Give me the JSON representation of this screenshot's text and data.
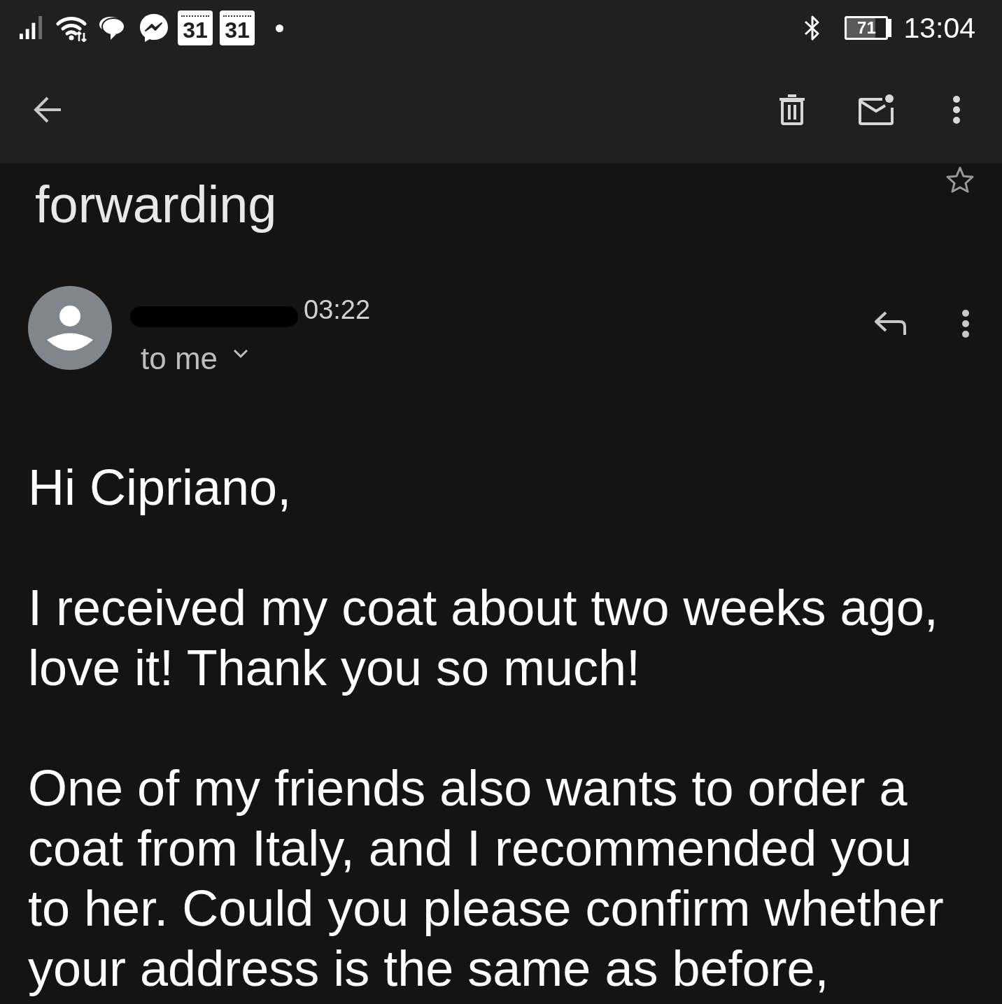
{
  "status_bar": {
    "calendar_badges": [
      "31",
      "31"
    ],
    "battery": "71",
    "time": "13:04"
  },
  "subject": {
    "title": "forwarding",
    "starred": false
  },
  "message": {
    "time": "03:22",
    "recipient": "to me",
    "body": [
      "Hi Cipriano,",
      "I received my coat about two weeks ago, love it! Thank you so much!",
      "One of my friends also wants to order a coat from Italy, and I recommended you to her. Could you please confirm whether your address is the same as before,"
    ]
  }
}
